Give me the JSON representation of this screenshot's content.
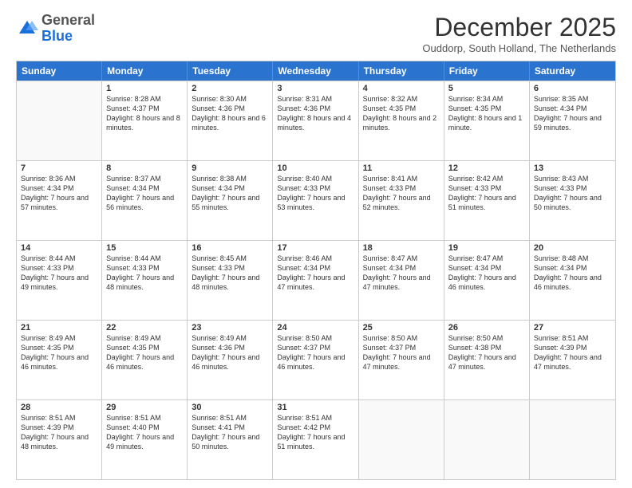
{
  "header": {
    "logo_general": "General",
    "logo_blue": "Blue",
    "month_title": "December 2025",
    "subtitle": "Ouddorp, South Holland, The Netherlands"
  },
  "days_of_week": [
    "Sunday",
    "Monday",
    "Tuesday",
    "Wednesday",
    "Thursday",
    "Friday",
    "Saturday"
  ],
  "weeks": [
    [
      {
        "day": "",
        "empty": true
      },
      {
        "day": "1",
        "sunrise": "8:28 AM",
        "sunset": "4:37 PM",
        "daylight": "8 hours and 8 minutes."
      },
      {
        "day": "2",
        "sunrise": "8:30 AM",
        "sunset": "4:36 PM",
        "daylight": "8 hours and 6 minutes."
      },
      {
        "day": "3",
        "sunrise": "8:31 AM",
        "sunset": "4:36 PM",
        "daylight": "8 hours and 4 minutes."
      },
      {
        "day": "4",
        "sunrise": "8:32 AM",
        "sunset": "4:35 PM",
        "daylight": "8 hours and 2 minutes."
      },
      {
        "day": "5",
        "sunrise": "8:34 AM",
        "sunset": "4:35 PM",
        "daylight": "8 hours and 1 minute."
      },
      {
        "day": "6",
        "sunrise": "8:35 AM",
        "sunset": "4:34 PM",
        "daylight": "7 hours and 59 minutes."
      }
    ],
    [
      {
        "day": "7",
        "sunrise": "8:36 AM",
        "sunset": "4:34 PM",
        "daylight": "7 hours and 57 minutes."
      },
      {
        "day": "8",
        "sunrise": "8:37 AM",
        "sunset": "4:34 PM",
        "daylight": "7 hours and 56 minutes."
      },
      {
        "day": "9",
        "sunrise": "8:38 AM",
        "sunset": "4:34 PM",
        "daylight": "7 hours and 55 minutes."
      },
      {
        "day": "10",
        "sunrise": "8:40 AM",
        "sunset": "4:33 PM",
        "daylight": "7 hours and 53 minutes."
      },
      {
        "day": "11",
        "sunrise": "8:41 AM",
        "sunset": "4:33 PM",
        "daylight": "7 hours and 52 minutes."
      },
      {
        "day": "12",
        "sunrise": "8:42 AM",
        "sunset": "4:33 PM",
        "daylight": "7 hours and 51 minutes."
      },
      {
        "day": "13",
        "sunrise": "8:43 AM",
        "sunset": "4:33 PM",
        "daylight": "7 hours and 50 minutes."
      }
    ],
    [
      {
        "day": "14",
        "sunrise": "8:44 AM",
        "sunset": "4:33 PM",
        "daylight": "7 hours and 49 minutes."
      },
      {
        "day": "15",
        "sunrise": "8:44 AM",
        "sunset": "4:33 PM",
        "daylight": "7 hours and 48 minutes."
      },
      {
        "day": "16",
        "sunrise": "8:45 AM",
        "sunset": "4:33 PM",
        "daylight": "7 hours and 48 minutes."
      },
      {
        "day": "17",
        "sunrise": "8:46 AM",
        "sunset": "4:34 PM",
        "daylight": "7 hours and 47 minutes."
      },
      {
        "day": "18",
        "sunrise": "8:47 AM",
        "sunset": "4:34 PM",
        "daylight": "7 hours and 47 minutes."
      },
      {
        "day": "19",
        "sunrise": "8:47 AM",
        "sunset": "4:34 PM",
        "daylight": "7 hours and 46 minutes."
      },
      {
        "day": "20",
        "sunrise": "8:48 AM",
        "sunset": "4:34 PM",
        "daylight": "7 hours and 46 minutes."
      }
    ],
    [
      {
        "day": "21",
        "sunrise": "8:49 AM",
        "sunset": "4:35 PM",
        "daylight": "7 hours and 46 minutes."
      },
      {
        "day": "22",
        "sunrise": "8:49 AM",
        "sunset": "4:35 PM",
        "daylight": "7 hours and 46 minutes."
      },
      {
        "day": "23",
        "sunrise": "8:49 AM",
        "sunset": "4:36 PM",
        "daylight": "7 hours and 46 minutes."
      },
      {
        "day": "24",
        "sunrise": "8:50 AM",
        "sunset": "4:37 PM",
        "daylight": "7 hours and 46 minutes."
      },
      {
        "day": "25",
        "sunrise": "8:50 AM",
        "sunset": "4:37 PM",
        "daylight": "7 hours and 47 minutes."
      },
      {
        "day": "26",
        "sunrise": "8:50 AM",
        "sunset": "4:38 PM",
        "daylight": "7 hours and 47 minutes."
      },
      {
        "day": "27",
        "sunrise": "8:51 AM",
        "sunset": "4:39 PM",
        "daylight": "7 hours and 47 minutes."
      }
    ],
    [
      {
        "day": "28",
        "sunrise": "8:51 AM",
        "sunset": "4:39 PM",
        "daylight": "7 hours and 48 minutes."
      },
      {
        "day": "29",
        "sunrise": "8:51 AM",
        "sunset": "4:40 PM",
        "daylight": "7 hours and 49 minutes."
      },
      {
        "day": "30",
        "sunrise": "8:51 AM",
        "sunset": "4:41 PM",
        "daylight": "7 hours and 50 minutes."
      },
      {
        "day": "31",
        "sunrise": "8:51 AM",
        "sunset": "4:42 PM",
        "daylight": "7 hours and 51 minutes."
      },
      {
        "day": "",
        "empty": true
      },
      {
        "day": "",
        "empty": true
      },
      {
        "day": "",
        "empty": true
      }
    ]
  ]
}
